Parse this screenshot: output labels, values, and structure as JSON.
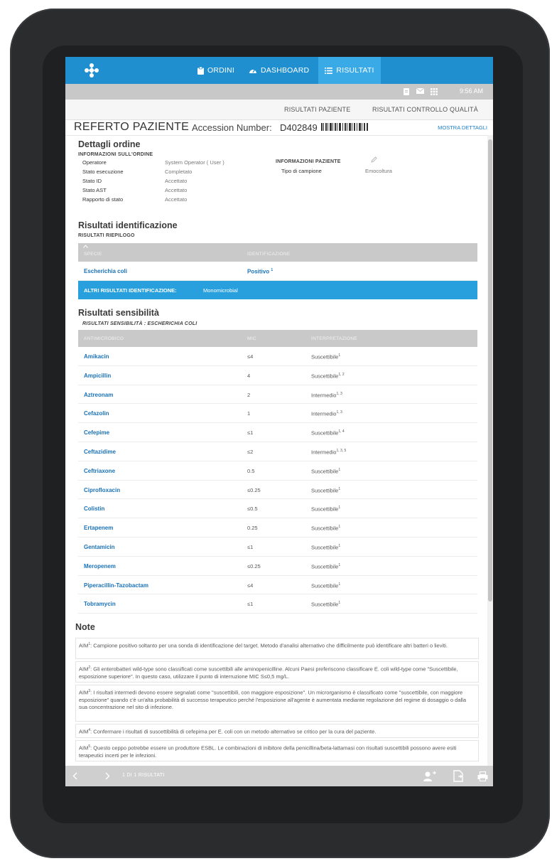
{
  "nav": {
    "tabs": [
      {
        "label": "ORDINI",
        "icon": "clipboard-icon"
      },
      {
        "label": "DASHBOARD",
        "icon": "gauge-icon"
      },
      {
        "label": "RISULTATI",
        "icon": "list-icon"
      }
    ],
    "active_tab": "RISULTATI",
    "accent_color": "#1f8fd0"
  },
  "status": {
    "time": "9:56 AM"
  },
  "subtabs": [
    "RISULTATI PAZIENTE",
    "RISULTATI CONTROLLO QUALITÀ"
  ],
  "report": {
    "title": "REFERTO PAZIENTE",
    "accession_label": "Accession Number:",
    "accession_number": "D402849",
    "show_details": "MOSTRA DETTAGLI"
  },
  "order": {
    "title": "Dettagli ordine",
    "info_header": "INFORMAZIONI SULL'ORDINE",
    "fields": [
      {
        "label": "Operatore",
        "value": "System Operator ( User )"
      },
      {
        "label": "Stato esecuzione",
        "value": "Completato"
      },
      {
        "label": "Stato ID",
        "value": "Accettato"
      },
      {
        "label": "Stato AST",
        "value": "Accettato"
      },
      {
        "label": "Rapporto di stato",
        "value": "Accettato"
      }
    ],
    "patient_header": "INFORMAZIONI PAZIENTE",
    "specimen_label": "Tipo di campione",
    "specimen_value": "Emocoltura"
  },
  "identification": {
    "title": "Risultati identificazione",
    "summary_header": "RISULTATI RIEPILOGO",
    "columns": [
      "SPECIE",
      "IDENTIFICAZIONE"
    ],
    "rows": [
      {
        "species": "Escherichia coli",
        "result": "Positivo",
        "sup": "1"
      }
    ],
    "other_label": "ALTRI RISULTATI IDENTIFICAZIONE:",
    "other_value": "Monomicrobial"
  },
  "susceptibility": {
    "title": "Risultati sensibilità",
    "subtitle": "RISULTATI SENSIBILITÀ :  ESCHERICHIA COLI",
    "columns": [
      "ANTIMICROBICO",
      "MIC",
      "INTERPRETAZIONE"
    ],
    "rows": [
      {
        "drug": "Amikacin",
        "mic": "≤4",
        "interp": "Suscettibile",
        "sup": "1"
      },
      {
        "drug": "Ampicillin",
        "mic": "4",
        "interp": "Suscettibile",
        "sup": "1, 2"
      },
      {
        "drug": "Aztreonam",
        "mic": "2",
        "interp": "Intermedio",
        "sup": "1, 3"
      },
      {
        "drug": "Cefazolin",
        "mic": "1",
        "interp": "Intermedio",
        "sup": "1, 3"
      },
      {
        "drug": "Cefepime",
        "mic": "≤1",
        "interp": "Suscettibile",
        "sup": "1, 4"
      },
      {
        "drug": "Ceftazidime",
        "mic": "≤2",
        "interp": "Intermedio",
        "sup": "1, 3, 5"
      },
      {
        "drug": "Ceftriaxone",
        "mic": "0.5",
        "interp": "Suscettibile",
        "sup": "1"
      },
      {
        "drug": "Ciprofloxacin",
        "mic": "≤0.25",
        "interp": "Suscettibile",
        "sup": "1"
      },
      {
        "drug": "Colistin",
        "mic": "≤0.5",
        "interp": "Suscettibile",
        "sup": "1"
      },
      {
        "drug": "Ertapenem",
        "mic": "0.25",
        "interp": "Suscettibile",
        "sup": "1"
      },
      {
        "drug": "Gentamicin",
        "mic": "≤1",
        "interp": "Suscettibile",
        "sup": "1"
      },
      {
        "drug": "Meropenem",
        "mic": "≤0.25",
        "interp": "Suscettibile",
        "sup": "1"
      },
      {
        "drug": "Piperacillin-Tazobactam",
        "mic": "≤4",
        "interp": "Suscettibile",
        "sup": "1"
      },
      {
        "drug": "Tobramycin",
        "mic": "≤1",
        "interp": "Suscettibile",
        "sup": "1"
      }
    ]
  },
  "notes": {
    "title": "Note",
    "items": [
      {
        "tag": "AIM",
        "sup": "1",
        "text": ": Campione positivo soltanto per una sonda di identificazione del target. Metodo d'analisi alternativo che difficilmente può identificare altri batteri o lieviti."
      },
      {
        "tag": "AIM",
        "sup": "2",
        "text": ": Gli enterobatteri wild-type sono classificati come suscettibili alle aminopenicilline. Alcuni Paesi preferiscono classificare E. coli wild-type come \"Suscettibile, esposizione superiore\". In questo caso, utilizzare il punto di interruzione MIC S≤0,5 mg/L."
      },
      {
        "tag": "AIM",
        "sup": "3",
        "text": ": I risultati intermedi devono essere segnalati come \"suscettibili, con maggiore esposizione\". Un microrganismo è classificato come \"suscettibile, con maggiore esposizione\" quando c'è un'alta probabilità di successo terapeutico perché l'esposizione all'agente è aumentata mediante regolazione del regime di dosaggio o dalla sua concentrazione nel sito di infezione."
      },
      {
        "tag": "AIM",
        "sup": "4",
        "text": ": Confermare i risultati di suscettibilità di cefepima per E. coli con un metodo alternativo se critico per la cura del paziente."
      },
      {
        "tag": "AIM",
        "sup": "5",
        "text": ": Questo ceppo potrebbe essere un produttore ESBL. Le combinazioni di inibitore della penicillina/beta-lattamasi con risultati suscettibili possono avere esiti terapeutici incerti per le infezioni."
      }
    ]
  },
  "footer": {
    "pager": "1 DI 1 RISULTATI"
  }
}
